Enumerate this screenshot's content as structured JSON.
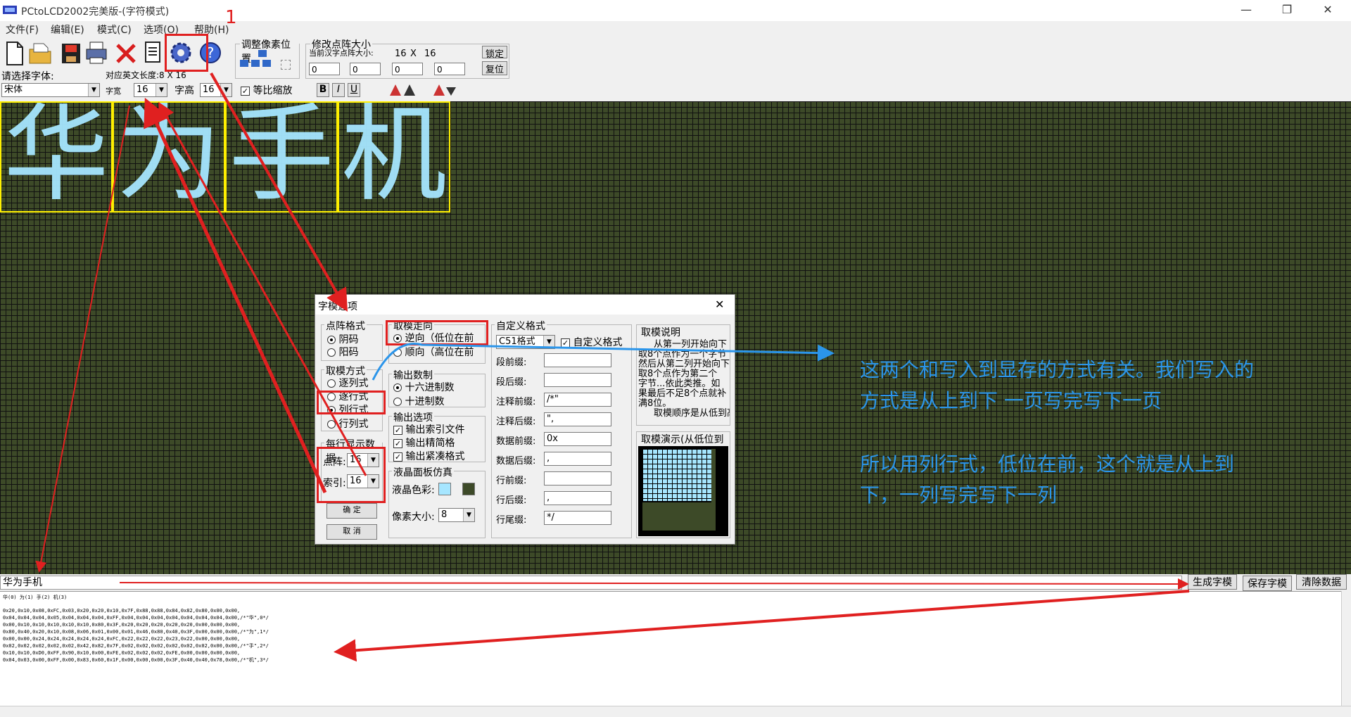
{
  "window": {
    "title": "PCtoLCD2002完美版-(字符模式)",
    "minimize_glyph": "—",
    "restore_glyph": "❐",
    "close_glyph": "✕"
  },
  "menu": [
    "文件(F)",
    "编辑(E)",
    "模式(C)",
    "选项(O)",
    "帮助(H)"
  ],
  "toolbar": {
    "icons": [
      "new-file-icon",
      "open-folder-icon",
      "save-icon",
      "print-icon",
      "delete-icon",
      "document-icon",
      "settings-gear-icon",
      "help-icon"
    ],
    "annotation_number": "1",
    "adjust_group_label": "调整像素位置",
    "resize_group_label": "修改点阵大小",
    "current_size_label": "当前汉字点阵大小:",
    "current_size_w": "16",
    "current_size_x": "X",
    "current_size_h": "16",
    "lock_button": "锁定",
    "reset_button": "复位",
    "spin_values": [
      "0",
      "0",
      "0",
      "0"
    ],
    "font_label": "请选择字体:",
    "font_value": "宋体",
    "english_width_label": "对应英文长度:8 X 16",
    "char_width_label": "字宽",
    "char_width_value": "16",
    "char_height_label": "字高",
    "char_height_value": "16",
    "proportional_label": "等比缩放",
    "format_buttons": [
      "B",
      "I",
      "U"
    ]
  },
  "lcd": {
    "pixel_color": "#a6e6ff",
    "background_color": "#3d4a28",
    "grid_box_color": "#ffef00",
    "characters": [
      "华",
      "为",
      "手",
      "机"
    ]
  },
  "bottom": {
    "input_value": "华为手机",
    "generate_button": "生成字模",
    "save_button": "保存字模",
    "clear_button": "清除数据",
    "index_line": "华(0) 为(1) 手(2) 机(3)",
    "code_lines": [
      "0x20,0x10,0x08,0xFC,0x03,0x20,0x20,0x10,0x7F,0x88,0x88,0x84,0x82,0x80,0x00,0x00,",
      "0x04,0x04,0x04,0x05,0x04,0x04,0x04,0xFF,0x04,0x04,0x04,0x04,0x04,0x04,0x04,0x00,/*\"华\",0*/",
      "0x00,0x10,0x10,0x10,0x10,0x10,0x80,0x3F,0x20,0x20,0x20,0x20,0x20,0x00,0x00,0x00,",
      "0x80,0x40,0x20,0x10,0x08,0x06,0x01,0x00,0x01,0x46,0x80,0x40,0x3F,0x00,0x00,0x00,/*\"为\",1*/",
      "0x00,0x00,0x24,0x24,0x24,0x24,0x24,0xFC,0x22,0x22,0x22,0x23,0x22,0x00,0x00,0x00,",
      "0x02,0x02,0x02,0x02,0x02,0x42,0x82,0x7F,0x02,0x02,0x02,0x02,0x02,0x02,0x00,0x00,/*\"手\",2*/",
      "0x10,0x10,0xD0,0xFF,0x90,0x10,0x00,0xFE,0x02,0x02,0x02,0xFE,0x00,0x00,0x00,0x00,",
      "0x04,0x03,0x00,0xFF,0x00,0x83,0x60,0x1F,0x00,0x00,0x00,0x3F,0x40,0x40,0x78,0x00,/*\"机\",3*/"
    ]
  },
  "dialog": {
    "title": "字模选项",
    "close_glyph": "✕",
    "dot_format": {
      "label": "点阵格式",
      "options": [
        "阴码",
        "阳码"
      ],
      "selected": 0
    },
    "mode": {
      "label": "取模方式",
      "options": [
        "逐列式",
        "逐行式",
        "列行式",
        "行列式"
      ],
      "selected": 2
    },
    "per_line": {
      "label": "每行显示数据",
      "dot_label": "点阵:",
      "dot_value": "16",
      "index_label": "索引:",
      "index_value": "16"
    },
    "ok_button": "确 定",
    "cancel_button": "取 消",
    "direction": {
      "label": "取模走向",
      "options": [
        "逆向（低位在前",
        "顺向（高位在前"
      ],
      "selected": 0
    },
    "number_format": {
      "label": "输出数制",
      "options": [
        "十六进制数",
        "十进制数"
      ],
      "selected": 0
    },
    "output_options": {
      "label": "输出选项",
      "options": [
        "输出索引文件",
        "输出精简格",
        "输出紧凑格式"
      ]
    },
    "lcd_sim": {
      "label": "液晶面板仿真",
      "color_label": "液晶色彩:",
      "pixel_size_label": "像素大小:",
      "pixel_size_value": "8"
    },
    "custom": {
      "label": "自定义格式",
      "format_value": "C51格式",
      "custom_check": "自定义格式",
      "fields": [
        {
          "label": "段前缀:",
          "value": ""
        },
        {
          "label": "段后缀:",
          "value": ""
        },
        {
          "label": "注释前缀:",
          "value": "/*\""
        },
        {
          "label": "注释后缀:",
          "value": "\","
        },
        {
          "label": "数据前缀:",
          "value": "0x"
        },
        {
          "label": "数据后缀:",
          "value": ","
        },
        {
          "label": "行前缀:",
          "value": ""
        },
        {
          "label": "行后缀:",
          "value": ","
        },
        {
          "label": "行尾缀:",
          "value": "*/"
        }
      ]
    },
    "explain": {
      "label": "取模说明",
      "lines": [
        "从第一列开始向下",
        "取8个点作为一个字节",
        "然后从第二列开始向下",
        "取8个点作为第二个",
        "字节...依此类推。如",
        "果最后不足8个点就补",
        "满8位。",
        "取模顺序是从低到高"
      ]
    },
    "demo": {
      "label": "取模演示(从低位到"
    }
  },
  "annotation": {
    "line1": "这两个和写入到显存的方式有关。我们写入的",
    "line2": "方式是从上到下 一页写完写下一页",
    "line3": "所以用列行式，低位在前，这个就是从上到",
    "line4": "下，一列写完写下一列"
  }
}
